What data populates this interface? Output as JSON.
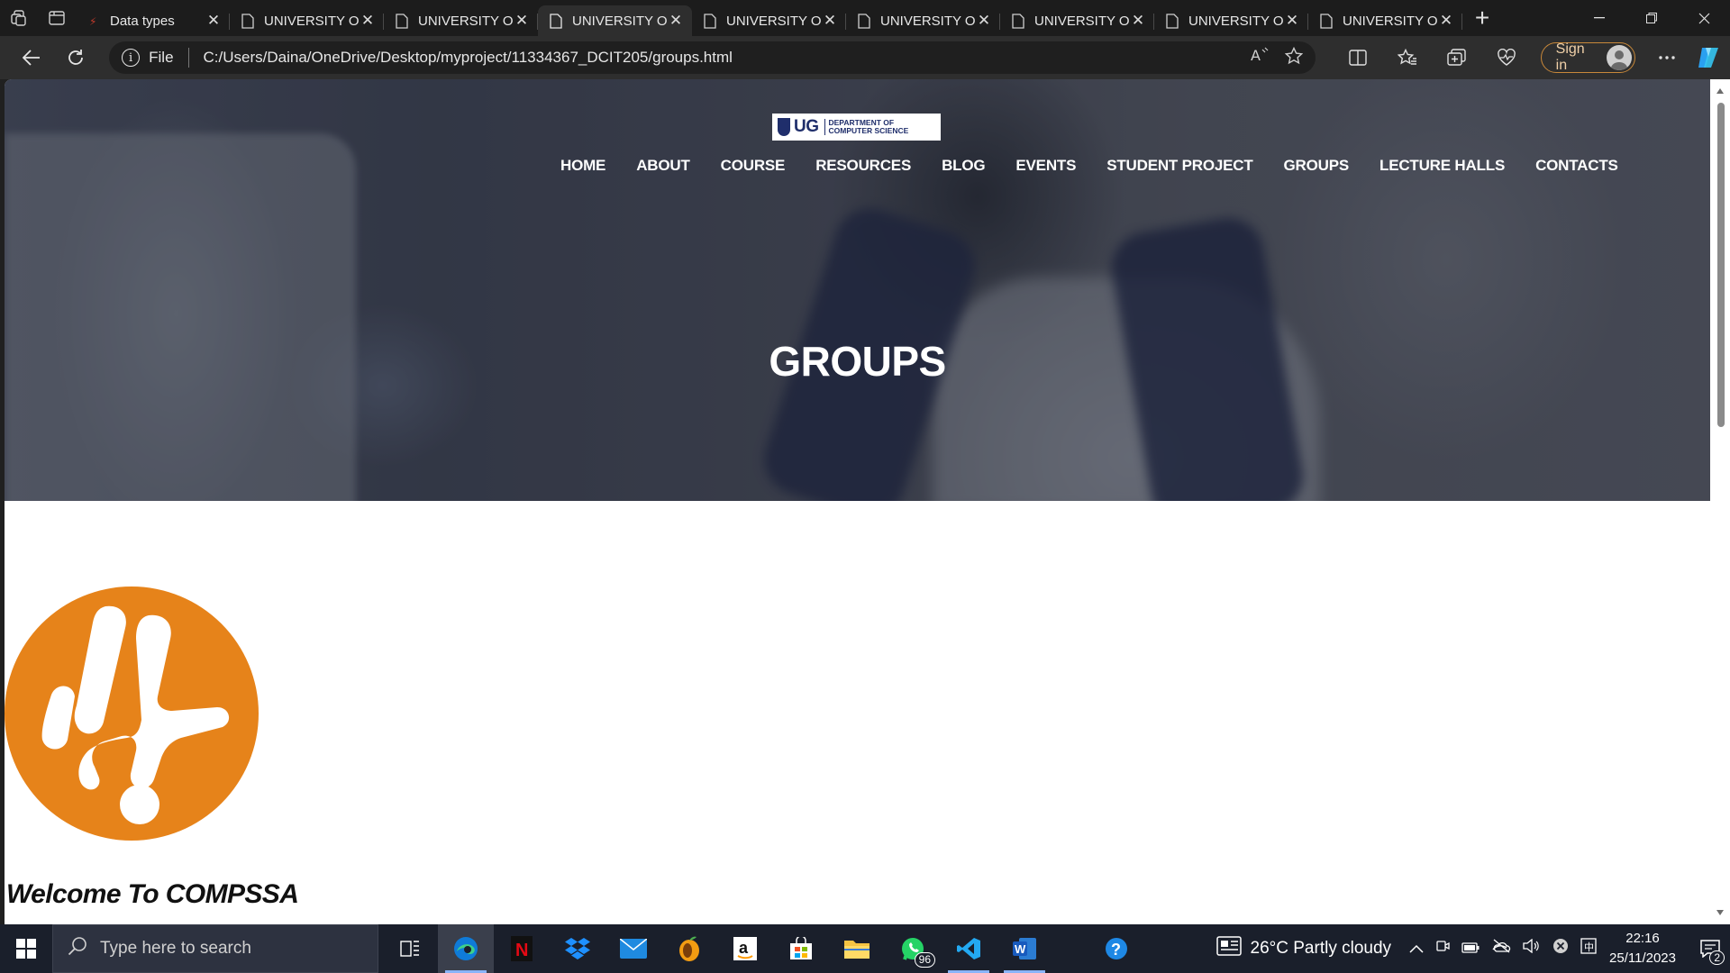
{
  "browser": {
    "tabs": [
      {
        "title": "Data types",
        "active": false
      },
      {
        "title": "UNIVERSITY OF GHANA",
        "active": false
      },
      {
        "title": "UNIVERSITY OF GHANA",
        "active": false
      },
      {
        "title": "UNIVERSITY OF GHANA",
        "active": true
      },
      {
        "title": "UNIVERSITY OF GHANA",
        "active": false
      },
      {
        "title": "UNIVERSITY OF GHANA",
        "active": false
      },
      {
        "title": "UNIVERSITY OF GHANA",
        "active": false
      },
      {
        "title": "UNIVERSITY OF GHANA",
        "active": false
      },
      {
        "title": "UNIVERSITY OF GHANA",
        "active": false
      }
    ],
    "address": {
      "scheme_label": "File",
      "url": "C:/Users/Daina/OneDrive/Desktop/myproject/11334367_DCIT205/groups.html"
    },
    "signin_label": "Sign in"
  },
  "site": {
    "logo": {
      "short": "UG",
      "dept_line1": "DEPARTMENT OF",
      "dept_line2": "COMPUTER SCIENCE"
    },
    "nav": [
      "HOME",
      "ABOUT",
      "COURSE",
      "RESOURCES",
      "BLOG",
      "EVENTS",
      "STUDENT PROJECT",
      "GROUPS",
      "LECTURE HALLS",
      "CONTACTS"
    ],
    "hero_title": "GROUPS",
    "welcome": "Welcome To COMPSSA",
    "accent_color": "#e6831a"
  },
  "taskbar": {
    "search_placeholder": "Type here to search",
    "whatsapp_badge": "96",
    "weather": "26°C  Partly cloudy",
    "time": "22:16",
    "date": "25/11/2023",
    "notifications": "2"
  }
}
